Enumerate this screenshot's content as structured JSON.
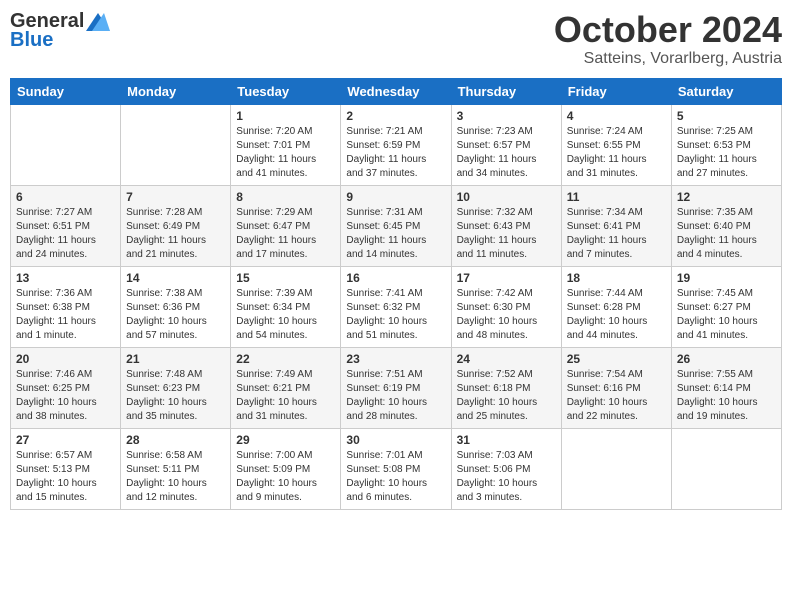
{
  "header": {
    "logo_general": "General",
    "logo_blue": "Blue",
    "month_title": "October 2024",
    "location": "Satteins, Vorarlberg, Austria"
  },
  "days_of_week": [
    "Sunday",
    "Monday",
    "Tuesday",
    "Wednesday",
    "Thursday",
    "Friday",
    "Saturday"
  ],
  "weeks": [
    [
      {
        "day": "",
        "info": ""
      },
      {
        "day": "",
        "info": ""
      },
      {
        "day": "1",
        "info": "Sunrise: 7:20 AM\nSunset: 7:01 PM\nDaylight: 11 hours and 41 minutes."
      },
      {
        "day": "2",
        "info": "Sunrise: 7:21 AM\nSunset: 6:59 PM\nDaylight: 11 hours and 37 minutes."
      },
      {
        "day": "3",
        "info": "Sunrise: 7:23 AM\nSunset: 6:57 PM\nDaylight: 11 hours and 34 minutes."
      },
      {
        "day": "4",
        "info": "Sunrise: 7:24 AM\nSunset: 6:55 PM\nDaylight: 11 hours and 31 minutes."
      },
      {
        "day": "5",
        "info": "Sunrise: 7:25 AM\nSunset: 6:53 PM\nDaylight: 11 hours and 27 minutes."
      }
    ],
    [
      {
        "day": "6",
        "info": "Sunrise: 7:27 AM\nSunset: 6:51 PM\nDaylight: 11 hours and 24 minutes."
      },
      {
        "day": "7",
        "info": "Sunrise: 7:28 AM\nSunset: 6:49 PM\nDaylight: 11 hours and 21 minutes."
      },
      {
        "day": "8",
        "info": "Sunrise: 7:29 AM\nSunset: 6:47 PM\nDaylight: 11 hours and 17 minutes."
      },
      {
        "day": "9",
        "info": "Sunrise: 7:31 AM\nSunset: 6:45 PM\nDaylight: 11 hours and 14 minutes."
      },
      {
        "day": "10",
        "info": "Sunrise: 7:32 AM\nSunset: 6:43 PM\nDaylight: 11 hours and 11 minutes."
      },
      {
        "day": "11",
        "info": "Sunrise: 7:34 AM\nSunset: 6:41 PM\nDaylight: 11 hours and 7 minutes."
      },
      {
        "day": "12",
        "info": "Sunrise: 7:35 AM\nSunset: 6:40 PM\nDaylight: 11 hours and 4 minutes."
      }
    ],
    [
      {
        "day": "13",
        "info": "Sunrise: 7:36 AM\nSunset: 6:38 PM\nDaylight: 11 hours and 1 minute."
      },
      {
        "day": "14",
        "info": "Sunrise: 7:38 AM\nSunset: 6:36 PM\nDaylight: 10 hours and 57 minutes."
      },
      {
        "day": "15",
        "info": "Sunrise: 7:39 AM\nSunset: 6:34 PM\nDaylight: 10 hours and 54 minutes."
      },
      {
        "day": "16",
        "info": "Sunrise: 7:41 AM\nSunset: 6:32 PM\nDaylight: 10 hours and 51 minutes."
      },
      {
        "day": "17",
        "info": "Sunrise: 7:42 AM\nSunset: 6:30 PM\nDaylight: 10 hours and 48 minutes."
      },
      {
        "day": "18",
        "info": "Sunrise: 7:44 AM\nSunset: 6:28 PM\nDaylight: 10 hours and 44 minutes."
      },
      {
        "day": "19",
        "info": "Sunrise: 7:45 AM\nSunset: 6:27 PM\nDaylight: 10 hours and 41 minutes."
      }
    ],
    [
      {
        "day": "20",
        "info": "Sunrise: 7:46 AM\nSunset: 6:25 PM\nDaylight: 10 hours and 38 minutes."
      },
      {
        "day": "21",
        "info": "Sunrise: 7:48 AM\nSunset: 6:23 PM\nDaylight: 10 hours and 35 minutes."
      },
      {
        "day": "22",
        "info": "Sunrise: 7:49 AM\nSunset: 6:21 PM\nDaylight: 10 hours and 31 minutes."
      },
      {
        "day": "23",
        "info": "Sunrise: 7:51 AM\nSunset: 6:19 PM\nDaylight: 10 hours and 28 minutes."
      },
      {
        "day": "24",
        "info": "Sunrise: 7:52 AM\nSunset: 6:18 PM\nDaylight: 10 hours and 25 minutes."
      },
      {
        "day": "25",
        "info": "Sunrise: 7:54 AM\nSunset: 6:16 PM\nDaylight: 10 hours and 22 minutes."
      },
      {
        "day": "26",
        "info": "Sunrise: 7:55 AM\nSunset: 6:14 PM\nDaylight: 10 hours and 19 minutes."
      }
    ],
    [
      {
        "day": "27",
        "info": "Sunrise: 6:57 AM\nSunset: 5:13 PM\nDaylight: 10 hours and 15 minutes."
      },
      {
        "day": "28",
        "info": "Sunrise: 6:58 AM\nSunset: 5:11 PM\nDaylight: 10 hours and 12 minutes."
      },
      {
        "day": "29",
        "info": "Sunrise: 7:00 AM\nSunset: 5:09 PM\nDaylight: 10 hours and 9 minutes."
      },
      {
        "day": "30",
        "info": "Sunrise: 7:01 AM\nSunset: 5:08 PM\nDaylight: 10 hours and 6 minutes."
      },
      {
        "day": "31",
        "info": "Sunrise: 7:03 AM\nSunset: 5:06 PM\nDaylight: 10 hours and 3 minutes."
      },
      {
        "day": "",
        "info": ""
      },
      {
        "day": "",
        "info": ""
      }
    ]
  ]
}
